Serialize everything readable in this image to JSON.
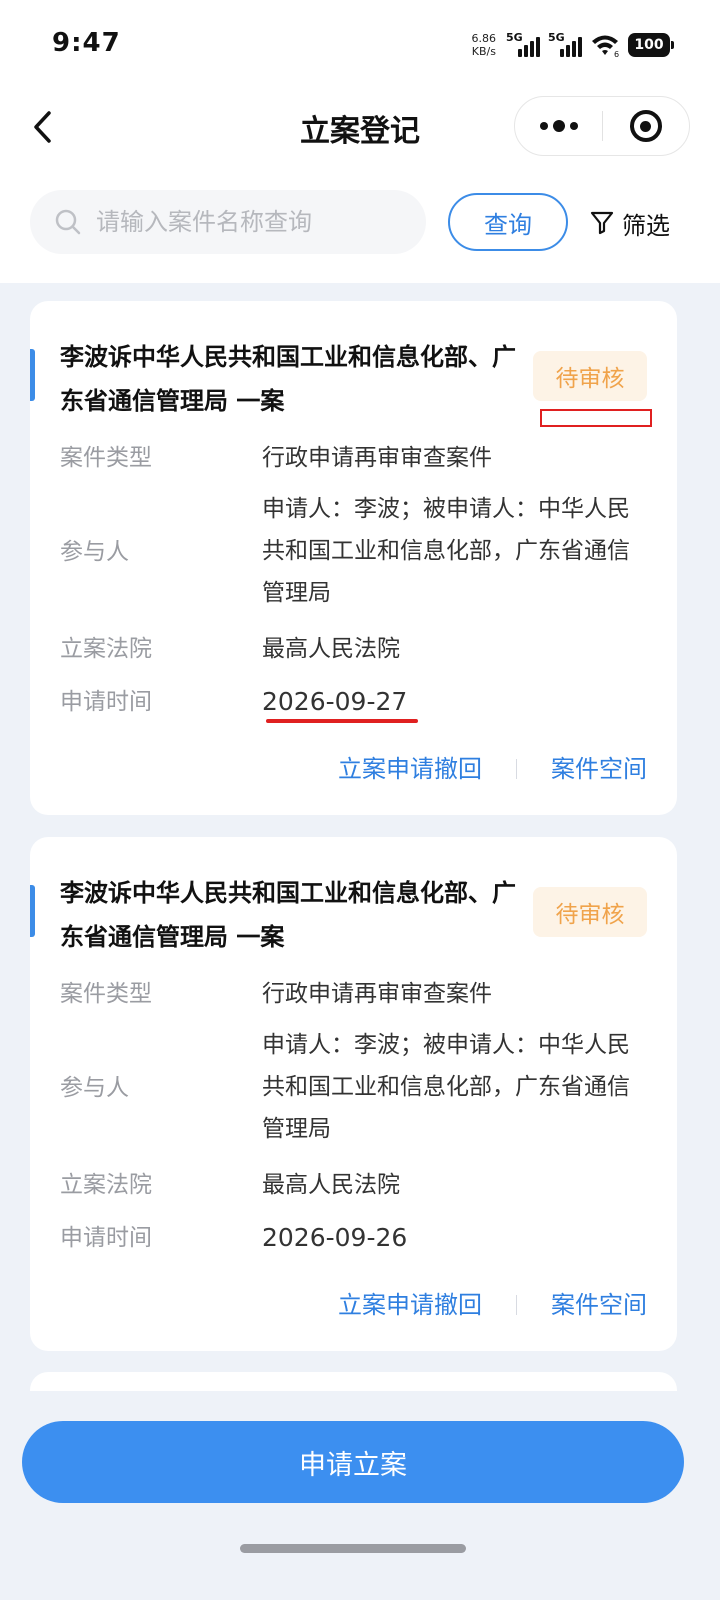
{
  "status_bar": {
    "time": "9:47",
    "net_speed_value": "6.86",
    "net_speed_unit": "KB/s",
    "sim1_tag": "5G",
    "sim2_tag": "5G",
    "wifi_badge": "6",
    "battery": "100"
  },
  "nav": {
    "title": "立案登记",
    "back_icon": "chevron-left-icon",
    "more_icon": "more-dots-icon",
    "close_icon": "target-circle-icon"
  },
  "search": {
    "placeholder": "请输入案件名称查询",
    "value": "",
    "query_label": "查询",
    "filter_label": "筛选"
  },
  "labels": {
    "type": "案件类型",
    "participants": "参与人",
    "court": "立案法院",
    "time": "申请时间"
  },
  "cases": [
    {
      "title": "李波诉中华人民共和国工业和信息化部、广东省通信管理局 一案",
      "status": "待审核",
      "type": "行政申请再审审查案件",
      "participants": "申请人：李波；被申请人：中华人民共和国工业和信息化部，广东省通信管理局",
      "court": "最高人民法院",
      "time": "2026-09-27",
      "action_withdraw": "立案申请撤回",
      "action_space": "案件空间"
    },
    {
      "title": "李波诉中华人民共和国工业和信息化部、广东省通信管理局 一案",
      "status": "待审核",
      "type": "行政申请再审审查案件",
      "participants": "申请人：李波；被申请人：中华人民共和国工业和信息化部，广东省通信管理局",
      "court": "最高人民法院",
      "time": "2026-09-26",
      "action_withdraw": "立案申请撤回",
      "action_space": "案件空间"
    }
  ],
  "apply_button": "申请立案",
  "colors": {
    "accent": "#3c8ce7",
    "status_text": "#f0a34b",
    "status_bg": "#fdf3e6",
    "annotation": "#e02020",
    "page_bg": "#eef2f8"
  }
}
